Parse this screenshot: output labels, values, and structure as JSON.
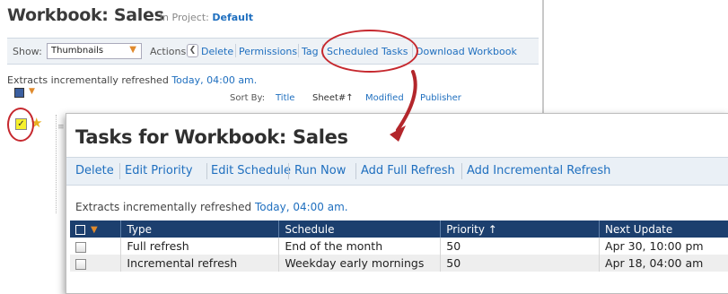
{
  "background": {
    "title": "Workbook: Sales",
    "project_prefix": "in Project:",
    "project_name": "Default",
    "show_label": "Show:",
    "show_value": "Thumbnails",
    "actions_label": "Actions:",
    "actions": [
      "Delete",
      "Permissions",
      "Tag",
      "Scheduled Tasks",
      "Download Workbook"
    ],
    "extract_text": "Extracts incrementally refreshed",
    "extract_link": "Today, 04:00 am.",
    "sort_label": "Sort By:",
    "sort_items": [
      "Title",
      "Sheet#↑",
      "Modified",
      "Publisher"
    ]
  },
  "tasks": {
    "title": "Tasks for Workbook: Sales",
    "actions": [
      "Delete",
      "Edit Priority",
      "Edit Schedule",
      "Run Now",
      "Add Full Refresh",
      "Add Incremental Refresh"
    ],
    "extract_text": "Extracts incrementally refreshed",
    "extract_link": "Today, 04:00 am.",
    "columns": [
      "Type",
      "Schedule",
      "Priority ↑",
      "Next Update"
    ],
    "rows": [
      {
        "type": "Full refresh",
        "schedule": "End of the month",
        "priority": "50",
        "next": "Apr 30, 10:00 pm"
      },
      {
        "type": "Incremental refresh",
        "schedule": "Weekday early mornings",
        "priority": "50",
        "next": "Apr 18, 04:00 am"
      }
    ]
  },
  "colors": {
    "link": "#1f6fbf",
    "header_bg": "#1c3f6e",
    "annotation_red": "#c6282e"
  }
}
